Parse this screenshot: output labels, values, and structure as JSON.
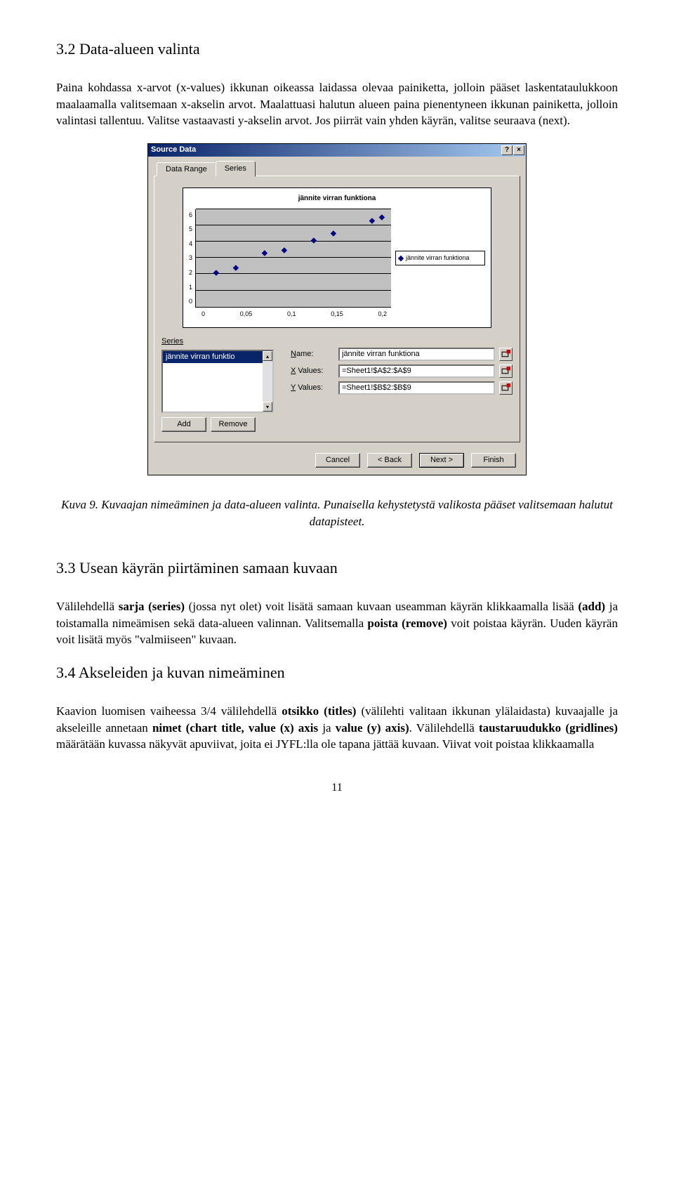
{
  "section32": {
    "heading": "3.2   Data-alueen valinta",
    "p1": "Paina kohdassa x-arvot (x-values) ikkunan oikeassa laidassa olevaa painiketta, jolloin pääset laskentataulukkoon maalaamalla valitsemaan x-akselin arvot. Maalattuasi halutun alueen paina pienentyneen ikkunan painiketta, jolloin valintasi tallentuu. Valitse vastaavasti y-akselin arvot. Jos piirrät vain yhden käyrän, valitse seuraava (next)."
  },
  "dialog": {
    "title": "Source Data",
    "help_btn": "?",
    "close_btn": "×",
    "tabs": {
      "data_range": "Data Range",
      "series": "Series"
    },
    "chart": {
      "title": "jännite virran funktiona",
      "legend": "jännite virran funktiona",
      "yticks": [
        "6",
        "5",
        "4",
        "3",
        "2",
        "1",
        "0"
      ],
      "xticks": [
        "0",
        "0,05",
        "0,1",
        "0,15",
        "0,2"
      ]
    },
    "series_label": "Series",
    "series_item": "jännite virran funktio",
    "add": "Add",
    "remove": "Remove",
    "name_label": "Name:",
    "name_value": "jännite virran funktiona",
    "xvalues_label": "X Values:",
    "xvalues_value": "=Sheet1!$A$2:$A$9",
    "yvalues_label": "Y Values:",
    "yvalues_value": "=Sheet1!$B$2:$B$9",
    "cancel": "Cancel",
    "back": "< Back",
    "next": "Next >",
    "finish": "Finish"
  },
  "caption": "Kuva 9. Kuvaajan nimeäminen ja data-alueen valinta. Punaisella kehystetystä valikosta pääset valitsemaan halutut datapisteet.",
  "section33": {
    "heading": "3.3   Usean käyrän piirtäminen samaan kuvaan",
    "p": "Välilehdellä sarja (series) (jossa nyt olet) voit lisätä samaan kuvaan useamman käyrän klikkaamalla lisää (add) ja toistamalla nimeämisen sekä data-alueen valinnan. Valitsemalla poista (remove) voit poistaa käyrän. Uuden käyrän voit lisätä myös \"valmiiseen\" kuvaan."
  },
  "section34": {
    "heading": "3.4   Akseleiden ja kuvan nimeäminen",
    "p": "Kaavion luomisen vaiheessa 3/4 välilehdellä otsikko (titles) (välilehti valitaan ikkunan ylälaidasta) kuvaajalle ja akseleille annetaan nimet (chart title, value (x) axis ja value (y) axis). Välilehdellä taustaruudukko (gridlines) määrätään kuvassa näkyvät apuviivat, joita ei JYFL:lla ole tapana jättää kuvaan. Viivat voit poistaa klikkaamalla"
  },
  "page_number": "11",
  "chart_data": {
    "type": "scatter",
    "title": "jännite virran funktiona",
    "series": [
      {
        "name": "jännite virran funktiona",
        "x": [
          0.02,
          0.04,
          0.07,
          0.09,
          0.12,
          0.14,
          0.18,
          0.19
        ],
        "y": [
          1.8,
          2.1,
          3.0,
          3.2,
          3.8,
          4.2,
          5.0,
          5.2
        ]
      }
    ],
    "xlabel": "",
    "ylabel": "",
    "xlim": [
      0,
      0.2
    ],
    "ylim": [
      0,
      6
    ]
  }
}
